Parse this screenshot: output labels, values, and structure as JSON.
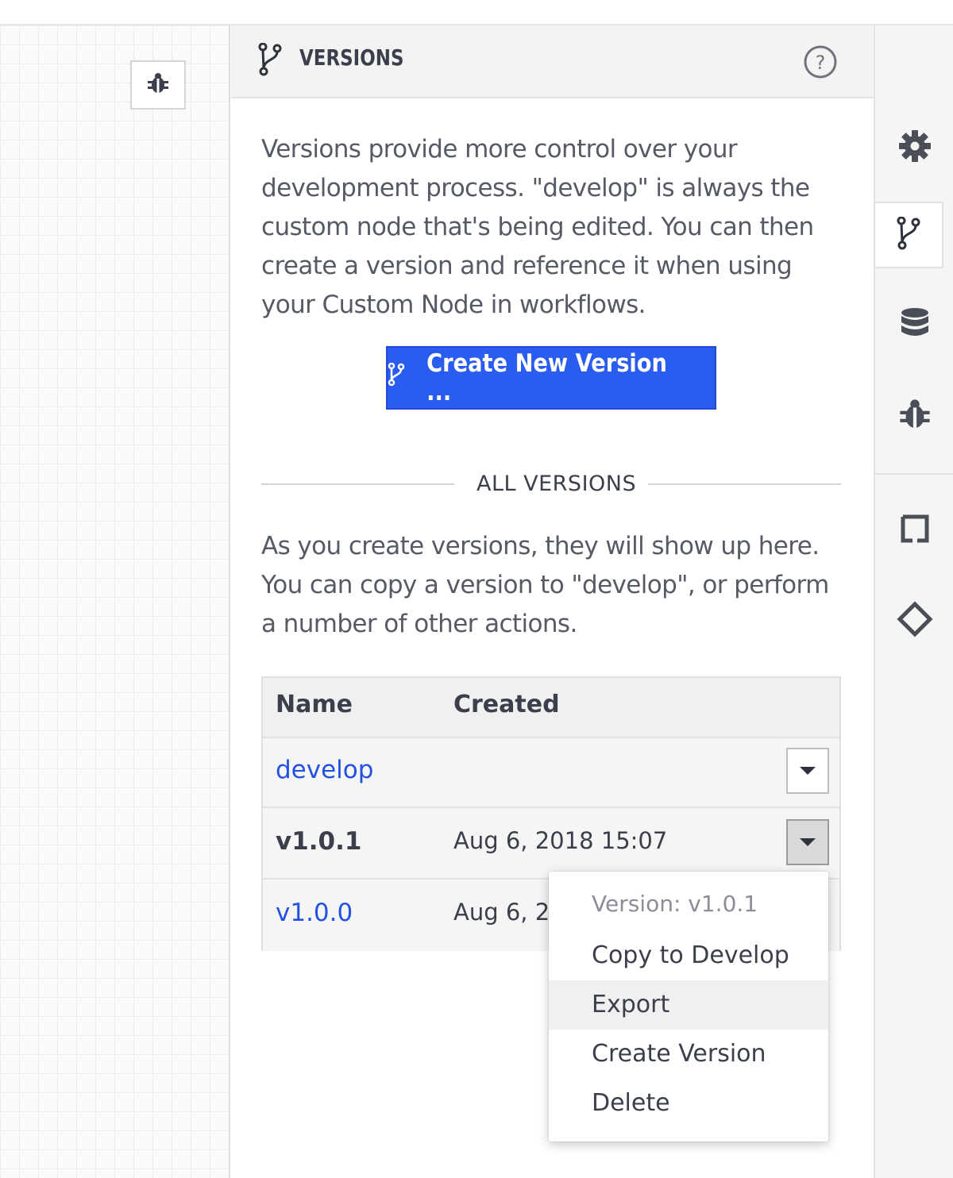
{
  "panel": {
    "title": "VERSIONS",
    "description": "Versions provide more control over your development process. \"develop\" is always the custom node that's being edited. You can then create a version and reference it when using your Custom Node in workflows.",
    "create_button_label": "Create New Version ...",
    "divider_label": "ALL VERSIONS",
    "list_description": "As you create versions, they will show up here. You can copy a version to \"develop\", or perform a number of other actions."
  },
  "table": {
    "columns": [
      "Name",
      "Created"
    ],
    "rows": [
      {
        "name": "develop",
        "created": ""
      },
      {
        "name": "v1.0.1",
        "created": "Aug 6, 2018 15:07"
      },
      {
        "name": "v1.0.0",
        "created": "Aug 6, 20"
      }
    ]
  },
  "menu": {
    "header": "Version: v1.0.1",
    "items": [
      "Copy to Develop",
      "Export",
      "Create Version",
      "Delete"
    ],
    "highlighted": "Export"
  },
  "rail": {
    "icons": [
      "gear-icon",
      "branch-icon",
      "database-icon",
      "bug-icon",
      "square-icon",
      "diamond-icon"
    ],
    "active": "branch-icon"
  },
  "colors": {
    "accent": "#2b5cf0",
    "link": "#2452e0",
    "text": "#3a3f4b"
  }
}
